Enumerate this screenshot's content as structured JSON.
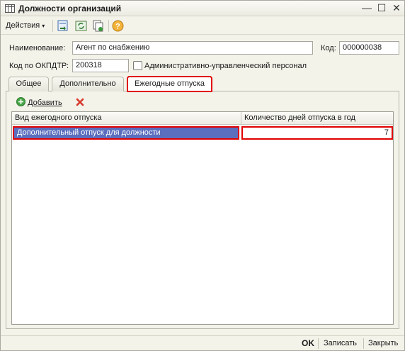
{
  "window": {
    "title": "Должности организаций",
    "minimize": "—",
    "maximize": "☐",
    "close": "✕"
  },
  "toolbar": {
    "actions_label": "Действия",
    "caret": "▾",
    "icons": [
      "navigate-icon",
      "refresh-icon",
      "copy-icon",
      "help-icon"
    ]
  },
  "form": {
    "name_label": "Наименование:",
    "name_value": "Агент по снабжению",
    "code_label": "Код:",
    "code_value": "000000038",
    "okpdtr_label": "Код по ОКПДТР:",
    "okpdtr_value": "200318",
    "admin_checkbox_label": "Административно-управленческий персонал",
    "admin_checked": false
  },
  "tabs": [
    {
      "label": "Общее",
      "active": false
    },
    {
      "label": "Дополнительно",
      "active": false
    },
    {
      "label": "Ежегодные отпуска",
      "active": true
    }
  ],
  "subtoolbar": {
    "add_label": "Добавить",
    "delete_icon": "delete-icon"
  },
  "grid": {
    "columns": [
      "Вид ежегодного отпуска",
      "Количество дней отпуска в год"
    ],
    "rows": [
      {
        "type": "Дополнительный отпуск для должности",
        "days": "7"
      }
    ],
    "selected_color": "#5b6fbe"
  },
  "footer": {
    "ok_label": "OK",
    "save_label": "Записать",
    "close_label": "Закрыть"
  }
}
